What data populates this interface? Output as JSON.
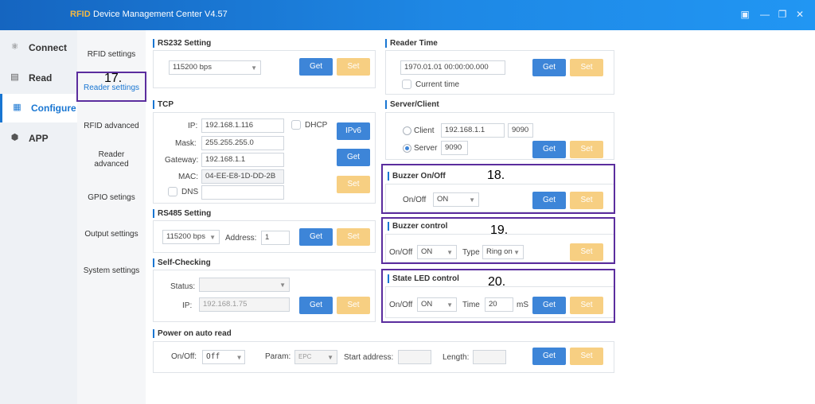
{
  "window": {
    "brand": "RFID",
    "title": "Device Management Center V4.57"
  },
  "nav": {
    "items": [
      {
        "label": "Connect",
        "icon": "network-icon"
      },
      {
        "label": "Read",
        "icon": "read-icon"
      },
      {
        "label": "Configure",
        "icon": "configure-icon"
      },
      {
        "label": "APP",
        "icon": "app-icon"
      }
    ],
    "active": "Configure"
  },
  "subnav": {
    "items": [
      "RFID settings",
      "Reader settings",
      "RFID advanced",
      "Reader advanced",
      "GPIO setings",
      "Output settings",
      "System settings"
    ],
    "active": "Reader settings"
  },
  "buttons": {
    "get": "Get",
    "set": "Set"
  },
  "rs232": {
    "title": "RS232 Setting",
    "baud": "115200 bps"
  },
  "tcp": {
    "title": "TCP",
    "ip_label": "IP:",
    "ip": "192.168.1.116",
    "mask_label": "Mask:",
    "mask": "255.255.255.0",
    "gateway_label": "Gateway:",
    "gateway": "192.168.1.1",
    "mac_label": "MAC:",
    "mac": "04-EE-E8-1D-DD-2B",
    "dhcp_label": "DHCP",
    "dns_label": "DNS",
    "ipv6_label": "IPv6"
  },
  "rs485": {
    "title": "RS485 Setting",
    "baud": "115200 bps",
    "address_label": "Address:",
    "address": "1"
  },
  "self_check": {
    "title": "Self-Checking",
    "status_label": "Status:",
    "ip_label": "IP:",
    "ip": "192.168.1.75"
  },
  "power_on": {
    "title": "Power on auto read",
    "onoff_label": "On/Off:",
    "onoff": "Off",
    "param_label": "Param:",
    "param": "EPC",
    "start_label": "Start address:",
    "length_label": "Length:"
  },
  "reader_time": {
    "title": "Reader Time",
    "value": "1970.01.01 00:00:00.000",
    "current_label": "Current time"
  },
  "server_client": {
    "title": "Server/Client",
    "client_label": "Client",
    "client_ip": "192.168.1.1",
    "client_port": "9090",
    "server_label": "Server",
    "server_port": "9090"
  },
  "buzzer_onoff": {
    "title": "Buzzer On/Off",
    "label": "On/Off",
    "value": "ON"
  },
  "buzzer_control": {
    "title": "Buzzer control",
    "onoff_label": "On/Off",
    "onoff": "ON",
    "type_label": "Type",
    "type": "Ring on"
  },
  "state_led": {
    "title": "State LED control",
    "onoff_label": "On/Off",
    "onoff": "ON",
    "time_label": "Time",
    "time": "20",
    "unit": "mS"
  },
  "annotations": [
    "17.",
    "18.",
    "19.",
    "20."
  ],
  "colors": {
    "accent": "#1976d2",
    "get_button": "#3d85d8",
    "set_button": "#f7cf82",
    "annotation": "#5b2d9e"
  }
}
